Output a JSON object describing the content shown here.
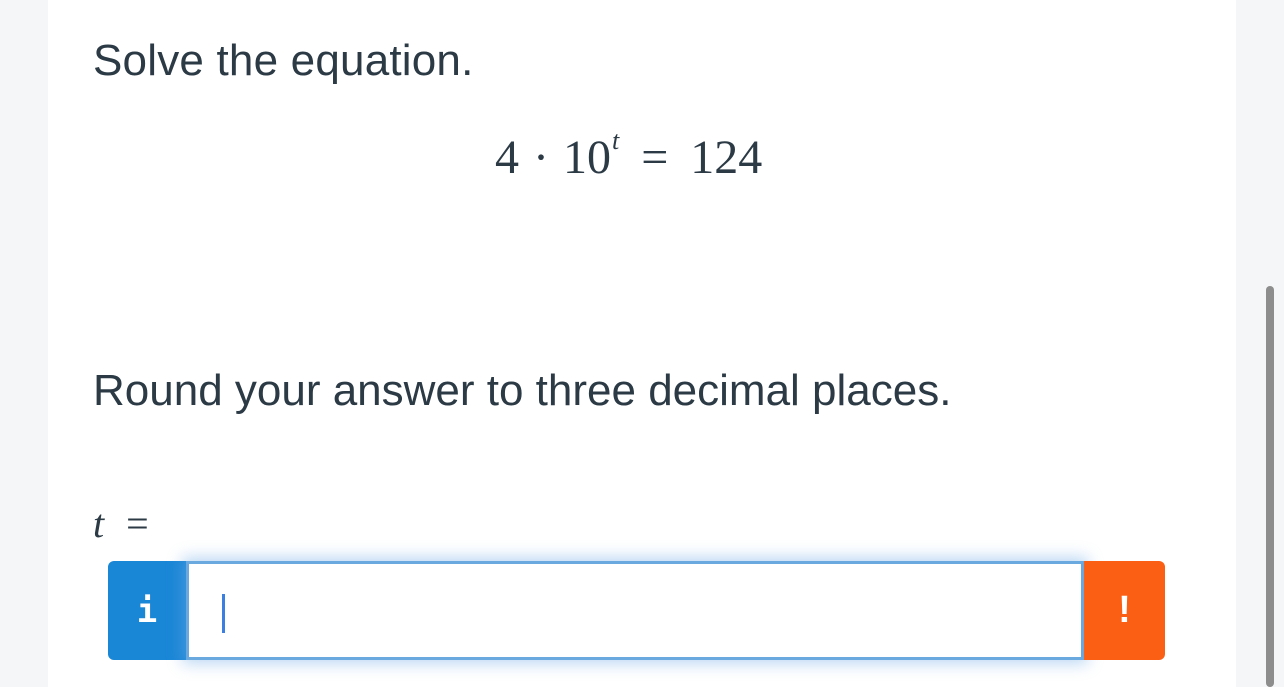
{
  "question": {
    "prompt": "Solve the equation.",
    "equation": {
      "coefficient": "4",
      "operator": "·",
      "base": "10",
      "exponent": "t",
      "equals": "=",
      "rhs": "124"
    },
    "instruction": "Round your answer to three decimal places.",
    "variable": "t",
    "variable_equals": "="
  },
  "answer": {
    "info_label": "i",
    "value": "",
    "alert_label": "!"
  },
  "colors": {
    "info_button": "#1a86d6",
    "alert_button": "#fb5f14",
    "input_border": "#6aa9e0",
    "text": "#2b3a45"
  },
  "icons": {
    "info": "info-icon",
    "alert": "exclamation-icon"
  }
}
